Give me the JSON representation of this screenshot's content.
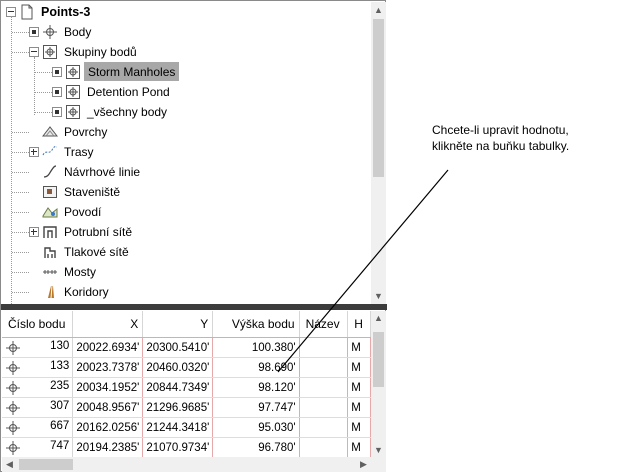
{
  "tree": {
    "items": [
      {
        "label": "Points-3",
        "icon": "drawing-icon",
        "expander": "minus",
        "level": 0
      },
      {
        "label": "Body",
        "icon": "point-icon",
        "expander": "dot",
        "level": 1
      },
      {
        "label": "Skupiny bodů",
        "icon": "point-group-icon",
        "expander": "minus",
        "level": 1
      },
      {
        "label": "Storm Manholes",
        "icon": "point-group-icon",
        "expander": "dot",
        "level": 2,
        "selected": true
      },
      {
        "label": "Detention Pond",
        "icon": "point-group-icon",
        "expander": "dot",
        "level": 2
      },
      {
        "label": "_všechny body",
        "icon": "point-group-icon",
        "expander": "dot",
        "level": 2
      },
      {
        "label": "Povrchy",
        "icon": "surface-icon",
        "expander": "none",
        "level": 1
      },
      {
        "label": "Trasy",
        "icon": "alignment-icon",
        "expander": "plus",
        "level": 1
      },
      {
        "label": "Návrhové linie",
        "icon": "feature-line-icon",
        "expander": "none",
        "level": 1
      },
      {
        "label": "Staveniště",
        "icon": "site-icon",
        "expander": "none",
        "level": 1
      },
      {
        "label": "Povodí",
        "icon": "catchment-icon",
        "expander": "none",
        "level": 1
      },
      {
        "label": "Potrubní sítě",
        "icon": "pipe-network-icon",
        "expander": "plus",
        "level": 1
      },
      {
        "label": "Tlakové sítě",
        "icon": "pressure-network-icon",
        "expander": "none",
        "level": 1
      },
      {
        "label": "Mosty",
        "icon": "bridge-icon",
        "expander": "none",
        "level": 1
      },
      {
        "label": "Koridory",
        "icon": "corridor-icon",
        "expander": "none",
        "level": 1
      }
    ]
  },
  "grid": {
    "columns": [
      "Číslo bodu",
      "X",
      "Y",
      "Výška bodu",
      "Název",
      "H"
    ],
    "rows": [
      {
        "number": "130",
        "x": "20022.6934'",
        "y": "20300.5410'",
        "elev": "100.380'",
        "name": "",
        "h": "M"
      },
      {
        "number": "133",
        "x": "20023.7378'",
        "y": "20460.0320'",
        "elev": "98.690'",
        "name": "",
        "h": "M"
      },
      {
        "number": "235",
        "x": "20034.1952'",
        "y": "20844.7349'",
        "elev": "98.120'",
        "name": "",
        "h": "M"
      },
      {
        "number": "307",
        "x": "20048.9567'",
        "y": "21296.9685'",
        "elev": "97.747'",
        "name": "",
        "h": "M"
      },
      {
        "number": "667",
        "x": "20162.0256'",
        "y": "21244.3418'",
        "elev": "95.030'",
        "name": "",
        "h": "M"
      },
      {
        "number": "747",
        "x": "20194.2385'",
        "y": "21070.9734'",
        "elev": "96.780'",
        "name": "",
        "h": "M"
      }
    ]
  },
  "callout": {
    "text_line1": "Chcete-li upravit hodnotu,",
    "text_line2": "klikněte na buňku tabulky."
  },
  "colors": {
    "selection": "#a8a8a8",
    "splitter": "#3c3c3c",
    "cell_border": "#e6a9a9"
  }
}
